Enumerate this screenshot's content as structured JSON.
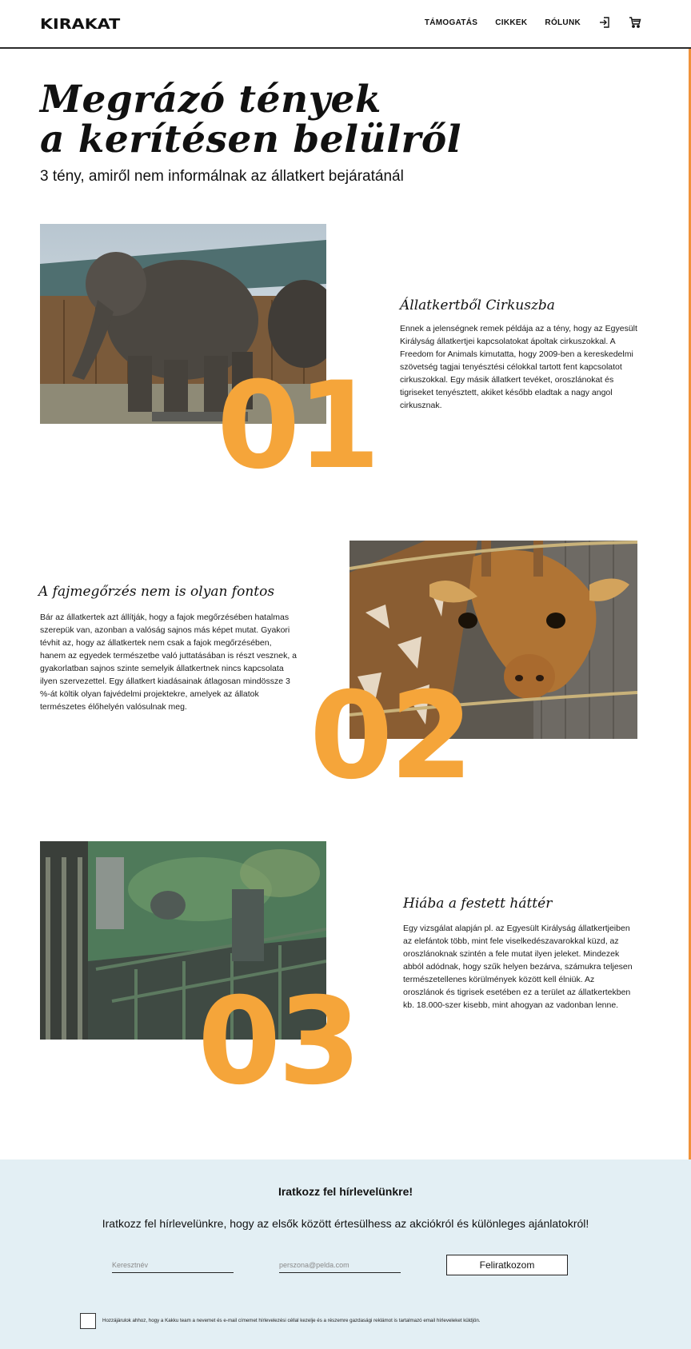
{
  "header": {
    "logo": "KIRAKAT",
    "nav": [
      "TÁMOGATÁS",
      "CIKKEK",
      "RÓLUNK"
    ],
    "login_icon": "login-icon",
    "cart_icon": "cart-icon"
  },
  "hero": {
    "title_line1": "Megrázó tények",
    "title_line2": "a kerítésen belülről",
    "subtitle": "3 tény, amiről nem informálnak az állatkert bejáratánál"
  },
  "facts": [
    {
      "number": "01",
      "title": "Állatkertből Cirkuszba",
      "text": "Ennek a jelenségnek remek példája az a tény, hogy az Egyesült Királyság állatkertjei kapcsolatokat ápoltak cirkuszokkal. A Freedom for Animals kimutatta, hogy 2009-ben a kereskedelmi szövetség tagjai tenyésztési célokkal tartott fent kapcsolatot cirkuszokkal. Egy másik állatkert tevéket, oroszlánokat és tigriseket tenyésztett, akiket később eladtak a nagy angol cirkusznak."
    },
    {
      "number": "02",
      "title": "A fajmegőrzés nem is olyan fontos",
      "text": "Bár az állatkertek azt állítják, hogy a fajok megőrzésében hatalmas szerepük van, azonban a valóság sajnos más képet mutat. Gyakori tévhit az, hogy az állatkertek nem csak a fajok megőrzésében, hanem az egyedek természetbe való juttatásában is részt vesznek, a gyakorlatban sajnos szinte semelyik állatkertnek nincs kapcsolata ilyen szervezettel. Egy állatkert kiadásainak átlagosan mindössze 3 %-át költik olyan fajvédelmi projektekre, amelyek az állatok természetes élőhelyén valósulnak meg."
    },
    {
      "number": "03",
      "title": "Hiába a festett háttér",
      "text": "Egy vizsgálat alapján pl. az Egyesült Királyság állatkertjeiben az elefántok több, mint fele viselkedészavarokkal küzd, az oroszlánoknak szintén a fele mutat ilyen jeleket. Mindezek abból adódnak, hogy szűk helyen bezárva, számukra teljesen természetellenes körülmények között kell élniük. Az oroszlánok és tigrisek esetében ez a terület az állatkertekben kb. 18.000-szer kisebb, mint ahogyan az vadonban lenne."
    }
  ],
  "newsletter": {
    "title": "Iratkozz fel hírlevelünkre!",
    "subtitle": "Iratkozz fel hírlevelünkre, hogy az elsők között értesülhess az akciókról és különleges ajánlatokról!",
    "name_placeholder": "Keresztnév",
    "email_placeholder": "perszona@pelda.com",
    "button_label": "Feliratkozom",
    "consent": "Hozzájárulok ahhoz, hogy a Kakku team a nevemet és e-mail címemet hírlevelezési céllal kezelje és a részemre gazdasági reklámot is tartalmazó email hírleveleket küldjön."
  },
  "colors": {
    "accent_orange": "#f5a53a",
    "newsletter_bg": "#e3eff4"
  }
}
